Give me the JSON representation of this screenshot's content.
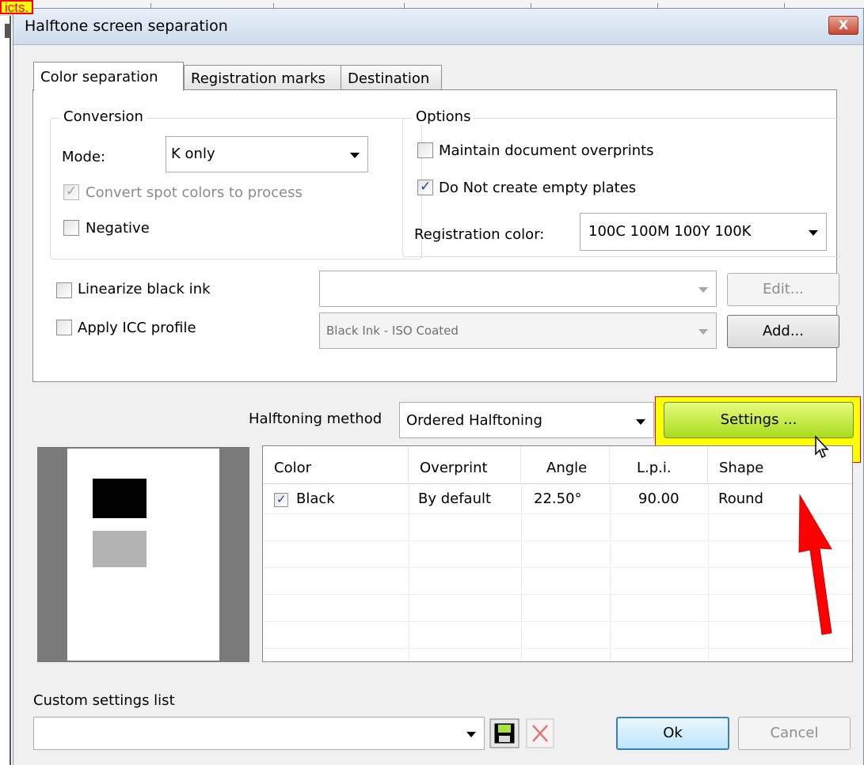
{
  "overlay": {
    "crop_label": "icts."
  },
  "dialog": {
    "title": "Halftone screen separation",
    "close_glyph": "X"
  },
  "tabs": [
    {
      "label": "Color separation"
    },
    {
      "label": "Registration marks"
    },
    {
      "label": "Destination"
    }
  ],
  "conversion": {
    "legend": "Conversion",
    "mode_label": "Mode:",
    "mode_value": "K only",
    "convert_spot_label": "Convert spot colors to process",
    "convert_spot_checked": true,
    "negative_label": "Negative",
    "negative_checked": false
  },
  "options": {
    "legend": "Options",
    "maintain_overprints_label": "Maintain document overprints",
    "maintain_overprints_checked": false,
    "no_empty_plates_label": "Do Not create empty plates",
    "no_empty_plates_checked": true,
    "registration_color_label": "Registration color:",
    "registration_color_value": "100C 100M 100Y 100K"
  },
  "linearize": {
    "label": "Linearize black ink",
    "checked": false,
    "value": "",
    "edit_button": "Edit..."
  },
  "icc": {
    "label": "Apply ICC profile",
    "checked": false,
    "value": "Black Ink - ISO Coated",
    "add_button": "Add..."
  },
  "halftoning": {
    "method_label": "Halftoning method",
    "method_value": "Ordered Halftoning",
    "settings_button": "Settings ..."
  },
  "grid": {
    "columns": [
      "Color",
      "Overprint",
      "Angle",
      "L.p.i.",
      "Shape"
    ],
    "rows": [
      {
        "checked": true,
        "color": "Black",
        "overprint": "By default",
        "angle": "22.50°",
        "lpi": "90.00",
        "shape": "Round"
      }
    ]
  },
  "custom_settings": {
    "label": "Custom settings list",
    "value": ""
  },
  "footer": {
    "ok_button": "Ok",
    "cancel_button": "Cancel"
  },
  "colors": {
    "highlight": "#ffff00",
    "settings_button": "#c6ec3f",
    "annotation_arrow": "#ff0000",
    "ok_focus": "#3c7fb1"
  },
  "icons": [
    "close-icon",
    "dropdown-arrow-icon",
    "checkmark-icon",
    "save-icon",
    "delete-icon",
    "mouse-cursor-icon",
    "red-arrow-annotation"
  ]
}
